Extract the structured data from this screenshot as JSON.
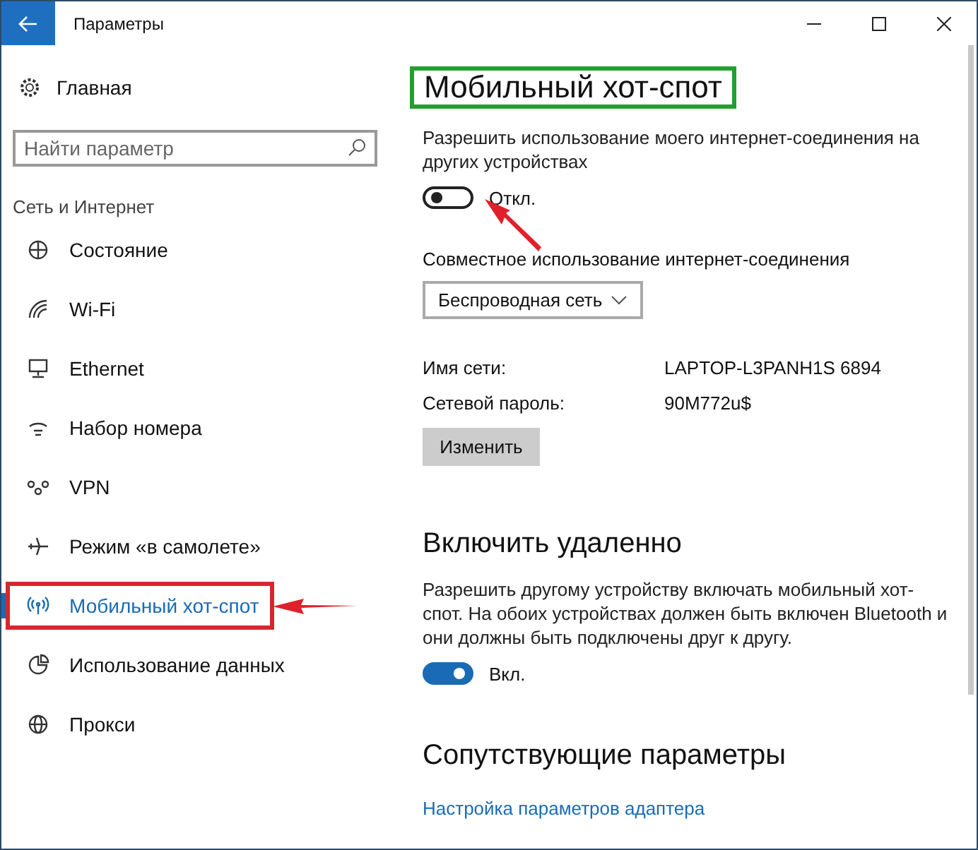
{
  "window": {
    "title": "Параметры"
  },
  "sidebar": {
    "home": "Главная",
    "search": {
      "placeholder": "Найти параметр"
    },
    "section": "Сеть и Интернет",
    "items": [
      {
        "label": "Состояние",
        "selected": false,
        "highlighted": false,
        "arrow": false
      },
      {
        "label": "Wi-Fi",
        "selected": false,
        "highlighted": false,
        "arrow": false
      },
      {
        "label": "Ethernet",
        "selected": false,
        "highlighted": false,
        "arrow": false
      },
      {
        "label": "Набор номера",
        "selected": false,
        "highlighted": false,
        "arrow": false
      },
      {
        "label": "VPN",
        "selected": false,
        "highlighted": false,
        "arrow": false
      },
      {
        "label": "Режим «в самолете»",
        "selected": false,
        "highlighted": false,
        "arrow": false
      },
      {
        "label": "Мобильный хот-спот",
        "selected": true,
        "highlighted": true,
        "arrow": true
      },
      {
        "label": "Использование данных",
        "selected": false,
        "highlighted": false,
        "arrow": false
      },
      {
        "label": "Прокси",
        "selected": false,
        "highlighted": false,
        "arrow": false
      }
    ]
  },
  "content": {
    "title": {
      "text": "Мобильный хот-спот",
      "highlighted": true
    },
    "share": {
      "description": "Разрешить использование моего интернет-соединения на других устройствах",
      "toggle": {
        "on": false,
        "label": "Откл.",
        "arrow": true
      }
    },
    "connection": {
      "label": "Совместное использование интернет-соединения",
      "dropdown": "Беспроводная сеть"
    },
    "details": [
      {
        "label": "Имя сети:",
        "value": "LAPTOP-L3PANH1S 6894"
      },
      {
        "label": "Сетевой пароль:",
        "value": "90M772u$"
      }
    ],
    "edit_button": "Изменить",
    "remote": {
      "heading": "Включить удаленно",
      "description": "Разрешить другому устройству включать мобильный хот-спот. На обоих устройствах должен быть включен Bluetooth и они должны быть подключены друг к другу.",
      "toggle": {
        "on": true,
        "label": "Вкл."
      }
    },
    "related": {
      "heading": "Сопутствующие параметры",
      "link": "Настройка параметров адаптера"
    }
  }
}
